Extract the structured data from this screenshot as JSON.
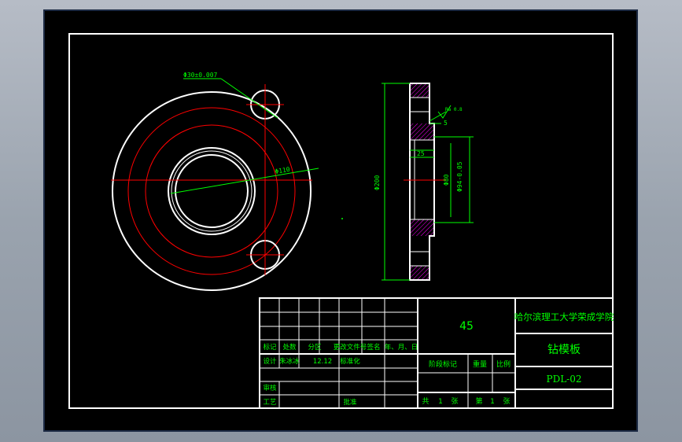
{
  "drawing": {
    "dimensions": {
      "hole_dia": "Φ30±0.007",
      "pcd_dia": "Φ110",
      "outer_dia": "Φ200",
      "bore_dia": "Φ80",
      "spigot_dia": "Φ94-0.05",
      "roughness": "Ra 0.8",
      "step_width": "25",
      "step_depth": "5"
    },
    "title_block": {
      "material": "45",
      "school": "哈尔滨理工大学荣成学院",
      "part_name": "钻模板",
      "drawing_no": "PDL-02",
      "rev_headers": [
        "标记",
        "处数",
        "分区",
        "更改文件号",
        "签名",
        "年、月、日"
      ],
      "design_label": "设计",
      "designer": "朱冰冰",
      "design_date": "12.12",
      "standardize_label": "标准化",
      "review_label": "审核",
      "process_label": "工艺",
      "approve_label": "批准",
      "stage_label": "阶段标记",
      "weight_label": "重量",
      "scale_label": "比例",
      "total_label": "共",
      "total_count": "1",
      "sheet_unit": "张",
      "page_label": "第",
      "page_num": "1",
      "page_unit": "张"
    },
    "colors": {
      "background": "#000000",
      "outline": "#ffffff",
      "center": "#ff0000",
      "dimension": "#00ff00",
      "hatch": "#ff00ff",
      "title_text": "#00ff00"
    }
  }
}
